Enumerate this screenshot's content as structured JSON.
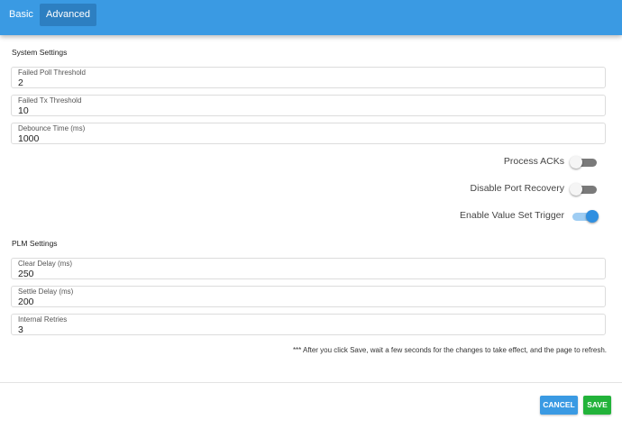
{
  "tabs": [
    {
      "label": "Basic",
      "active": false
    },
    {
      "label": "Advanced",
      "active": true
    }
  ],
  "system_settings": {
    "title": "System Settings",
    "fields": [
      {
        "label": "Failed Poll Threshold",
        "value": "2"
      },
      {
        "label": "Failed Tx Threshold",
        "value": "10"
      },
      {
        "label": "Debounce Time (ms)",
        "value": "1000"
      }
    ],
    "toggles": [
      {
        "label": "Process ACKs",
        "on": false
      },
      {
        "label": "Disable Port Recovery",
        "on": false
      },
      {
        "label": "Enable Value Set Trigger",
        "on": true
      }
    ]
  },
  "plm_settings": {
    "title": "PLM Settings",
    "fields": [
      {
        "label": "Clear Delay (ms)",
        "value": "250"
      },
      {
        "label": "Settle Delay (ms)",
        "value": "200"
      },
      {
        "label": "Internal Retries",
        "value": "3"
      }
    ]
  },
  "note": "*** After you click Save, wait a few seconds for the changes to take effect, and the page to refresh.",
  "buttons": {
    "cancel": "CANCEL",
    "save": "SAVE"
  },
  "colors": {
    "header": "#3a9ae3",
    "active_tab": "#2d7fc1",
    "save": "#22b33a",
    "toggle_on": "#2f8fe0"
  }
}
